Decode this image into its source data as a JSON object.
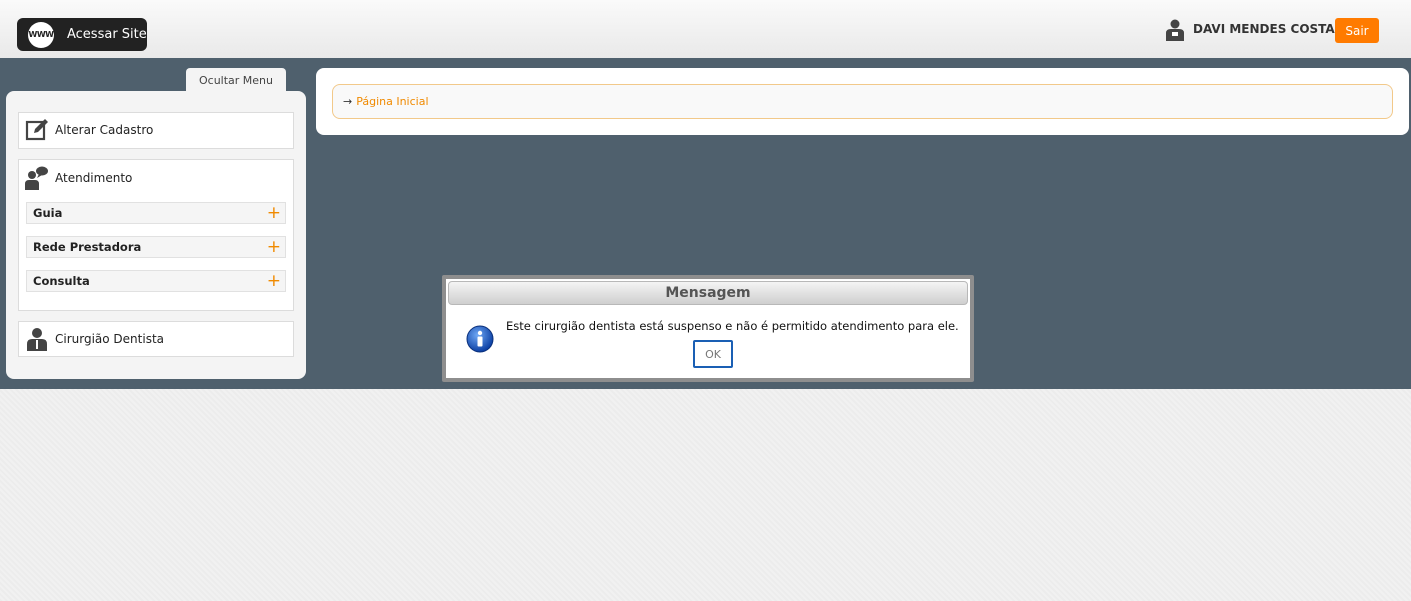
{
  "header": {
    "site_button": {
      "icon_text": "WWW",
      "label": "Acessar Site"
    },
    "user_name": "DAVI MENDES COSTA",
    "logout_label": "Sair"
  },
  "sidebar": {
    "hide_menu_label": "Ocultar Menu",
    "items": [
      {
        "label": "Alterar Cadastro",
        "icon": "edit-icon"
      },
      {
        "label": "Atendimento",
        "icon": "chat-user-icon",
        "subitems": [
          {
            "label": "Guia"
          },
          {
            "label": "Rede Prestadora"
          },
          {
            "label": "Consulta"
          }
        ]
      },
      {
        "label": "Cirurgião Dentista",
        "icon": "dentist-icon"
      }
    ]
  },
  "breadcrumb": {
    "arrow": "→",
    "current": "Página Inicial"
  },
  "dialog": {
    "title": "Mensagem",
    "message": "Este cirurgião dentista está suspenso e não é permitido atendimento para ele.",
    "ok_label": "OK"
  },
  "colors": {
    "accent_orange": "#ff7b00",
    "main_bg": "#4f606d",
    "link_orange": "#f08a00"
  }
}
